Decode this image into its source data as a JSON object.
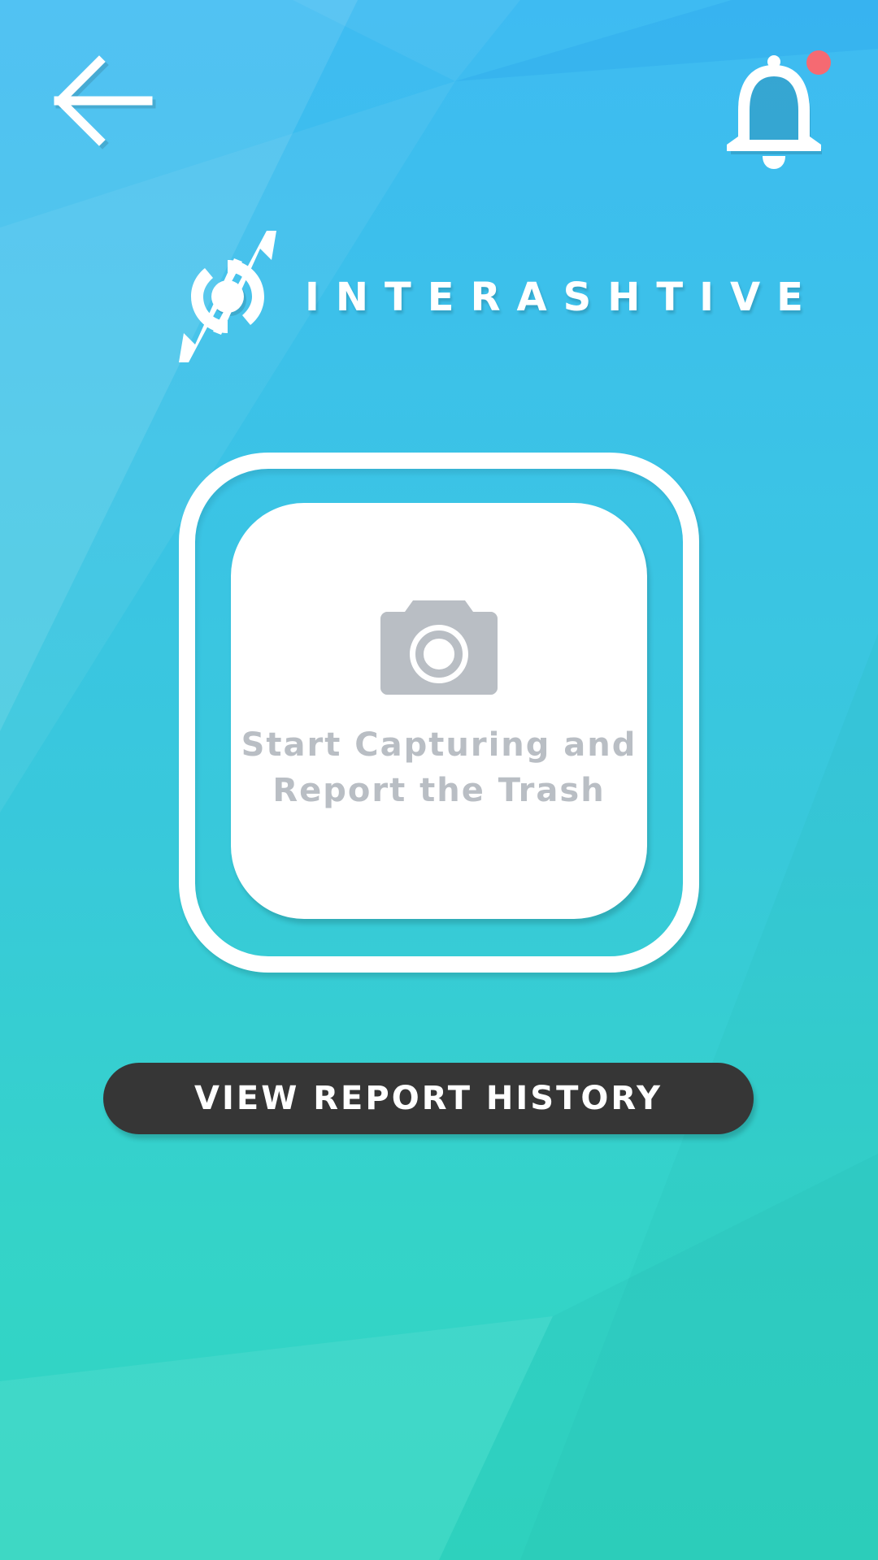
{
  "header": {
    "back_icon": "arrow-left-icon",
    "notification_icon": "bell-icon",
    "has_unread_notifications": true,
    "notification_dot_color": "#f56a72"
  },
  "brand": {
    "logo_icon": "recycle-arrows-icon",
    "name": "INTERASHTIVE"
  },
  "capture": {
    "icon": "camera-icon",
    "label": "Start Capturing and\nReport the Trash"
  },
  "actions": {
    "view_history_label": "VIEW REPORT HISTORY"
  },
  "colors": {
    "gradient_top": "#3ebbf2",
    "gradient_bottom": "#30d6c0",
    "button_dark": "#363636",
    "muted_text": "#b9bec4"
  }
}
